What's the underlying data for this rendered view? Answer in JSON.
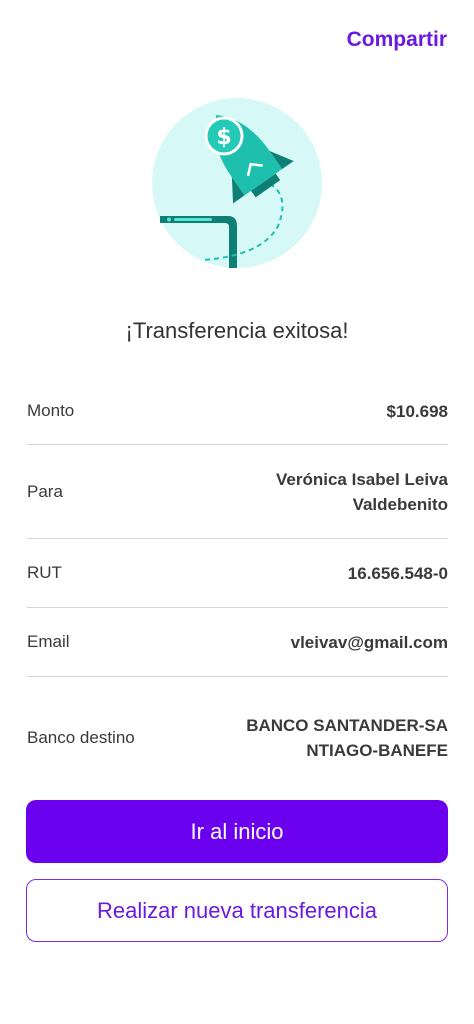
{
  "header": {
    "share_label": "Compartir"
  },
  "illustration": {
    "icon": "rocket-money-icon"
  },
  "title": "¡Transferencia exitosa!",
  "details": {
    "monto": {
      "label": "Monto",
      "value": "$10.698"
    },
    "para": {
      "label": "Para",
      "value": "Verónica Isabel Leiva Valdebenito"
    },
    "rut": {
      "label": "RUT",
      "value": "16.656.548-0"
    },
    "email": {
      "label": "Email",
      "value": "vleivav@gmail.com"
    },
    "banco": {
      "label": "Banco destino",
      "value": "BANCO SANTANDER-SANTIAGO-BANEFE"
    }
  },
  "actions": {
    "primary_label": "Ir al inicio",
    "secondary_label": "Realizar nueva transferencia"
  },
  "colors": {
    "accent": "#6b00ee",
    "illustration_bg": "#d6f8f6",
    "teal": "#1fbfae",
    "dark_teal": "#0d7f74"
  }
}
